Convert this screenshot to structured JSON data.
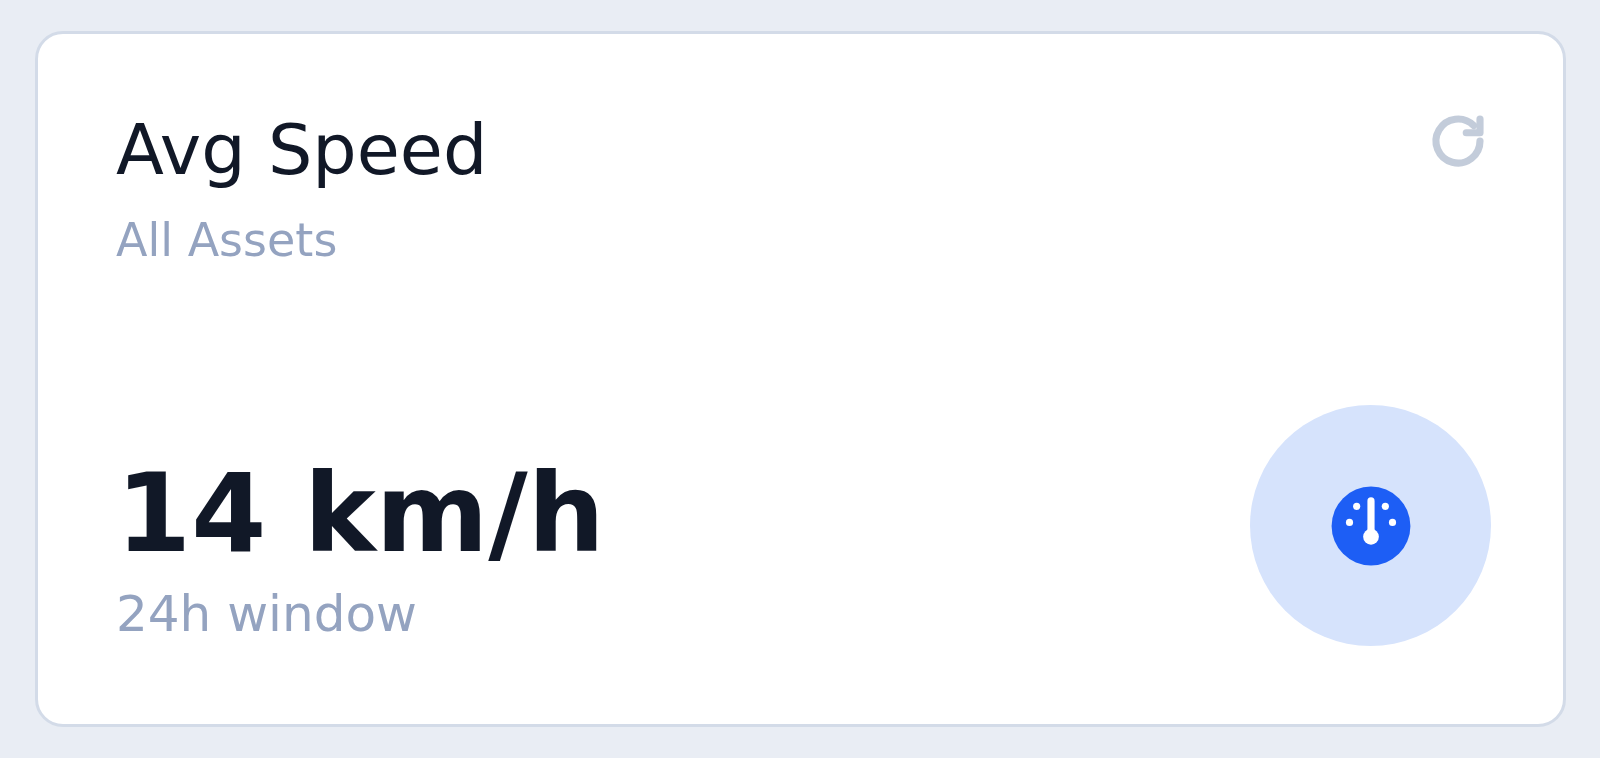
{
  "card": {
    "title": "Avg Speed",
    "subtitle": "All Assets",
    "value": "14 km/h",
    "caption": "24h window"
  }
}
